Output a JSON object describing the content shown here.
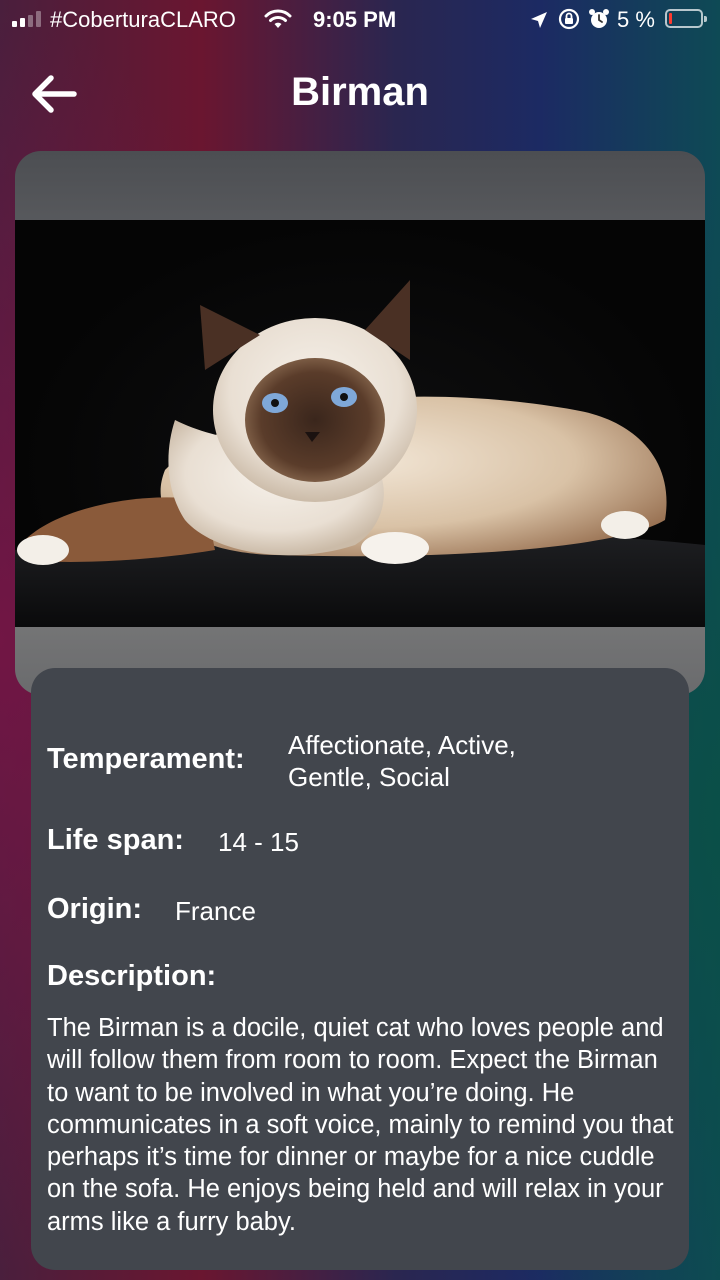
{
  "status_bar": {
    "carrier": "#CoberturaCLARO",
    "time": "9:05 PM",
    "battery": "5 %",
    "battery_level_fraction": 0.05,
    "icons": [
      "signal-icon",
      "wifi-icon",
      "location-arrow-icon",
      "orientation-lock-icon",
      "alarm-icon",
      "battery-icon"
    ]
  },
  "header": {
    "title": "Birman",
    "back_icon": "arrow-left-icon"
  },
  "image": {
    "subject": "cat-photo"
  },
  "details": {
    "temperament_label": "Temperament:",
    "temperament_line1": "Affectionate, Active,",
    "temperament_line2": "Gentle, Social",
    "life_span_label": "Life span:",
    "life_span_value": "14 - 15",
    "origin_label": "Origin:",
    "origin_value": "France",
    "description_label": "Description:",
    "description_text": "The Birman is a docile, quiet cat who loves people and will follow them from room to room. Expect the Birman to want to be involved in what you’re doing. He communicates in a soft voice, mainly to remind you that perhaps it’s time for dinner or maybe for a nice cuddle on the sofa. He enjoys being held and will relax in your arms like a furry baby."
  },
  "colors": {
    "card_background": "#42464d",
    "text": "#ffffff",
    "battery_low": "#ff3b30"
  }
}
